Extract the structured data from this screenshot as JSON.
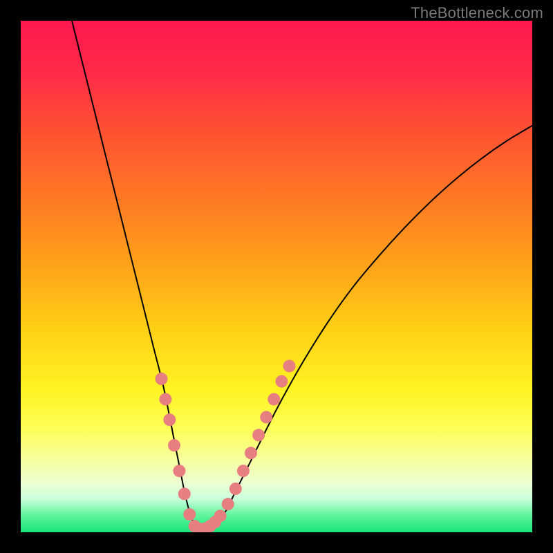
{
  "watermark": "TheBottleneck.com",
  "colors": {
    "frame": "#000000",
    "watermark": "#7a7a7a",
    "curve": "#000000",
    "dot_fill": "#e77f80",
    "gradient_stops": [
      {
        "offset": 0.0,
        "color": "#ff1850"
      },
      {
        "offset": 0.1,
        "color": "#ff2a48"
      },
      {
        "offset": 0.22,
        "color": "#ff5232"
      },
      {
        "offset": 0.35,
        "color": "#ff7a24"
      },
      {
        "offset": 0.48,
        "color": "#ffa31a"
      },
      {
        "offset": 0.6,
        "color": "#ffcf16"
      },
      {
        "offset": 0.72,
        "color": "#fff322"
      },
      {
        "offset": 0.8,
        "color": "#fdff59"
      },
      {
        "offset": 0.86,
        "color": "#f7ffa1"
      },
      {
        "offset": 0.905,
        "color": "#ecffd2"
      },
      {
        "offset": 0.935,
        "color": "#c9ffdc"
      },
      {
        "offset": 0.965,
        "color": "#64f59e"
      },
      {
        "offset": 1.0,
        "color": "#17e676"
      }
    ]
  },
  "chart_data": {
    "type": "line",
    "title": "",
    "xlabel": "",
    "ylabel": "",
    "xlim": [
      0,
      100
    ],
    "ylim": [
      0,
      100
    ],
    "grid": false,
    "legend": false,
    "series": [
      {
        "name": "bottleneck-curve",
        "x": [
          10,
          12,
          14,
          16,
          18,
          20,
          22,
          24,
          26,
          28,
          30,
          31,
          32,
          33,
          34,
          35,
          36,
          38,
          40,
          42,
          45,
          50,
          55,
          60,
          65,
          70,
          75,
          80,
          85,
          90,
          95,
          100
        ],
        "y": [
          100,
          92,
          84,
          76,
          68,
          60,
          52,
          44,
          36,
          28,
          18,
          13,
          8,
          4,
          1.5,
          0.7,
          0.7,
          1.6,
          4,
          8,
          14,
          24,
          33,
          41,
          48,
          54,
          59.5,
          64.5,
          69,
          73,
          76.5,
          79.5
        ]
      }
    ],
    "highlight_points": {
      "name": "threshold-dots",
      "points": [
        {
          "x": 27.5,
          "y": 30
        },
        {
          "x": 28.3,
          "y": 26
        },
        {
          "x": 29.1,
          "y": 22
        },
        {
          "x": 30.0,
          "y": 17
        },
        {
          "x": 31.0,
          "y": 12
        },
        {
          "x": 32.0,
          "y": 7.5
        },
        {
          "x": 33.0,
          "y": 3.5
        },
        {
          "x": 34.0,
          "y": 1.2
        },
        {
          "x": 35.0,
          "y": 0.6
        },
        {
          "x": 36.0,
          "y": 0.7
        },
        {
          "x": 37.0,
          "y": 1.2
        },
        {
          "x": 38.0,
          "y": 2.0
        },
        {
          "x": 39.0,
          "y": 3.2
        },
        {
          "x": 40.5,
          "y": 5.5
        },
        {
          "x": 42.0,
          "y": 8.5
        },
        {
          "x": 43.5,
          "y": 12
        },
        {
          "x": 45.0,
          "y": 15.5
        },
        {
          "x": 46.5,
          "y": 19
        },
        {
          "x": 48.0,
          "y": 22.5
        },
        {
          "x": 49.5,
          "y": 26
        },
        {
          "x": 51.0,
          "y": 29.5
        },
        {
          "x": 52.5,
          "y": 32.5
        }
      ]
    }
  }
}
